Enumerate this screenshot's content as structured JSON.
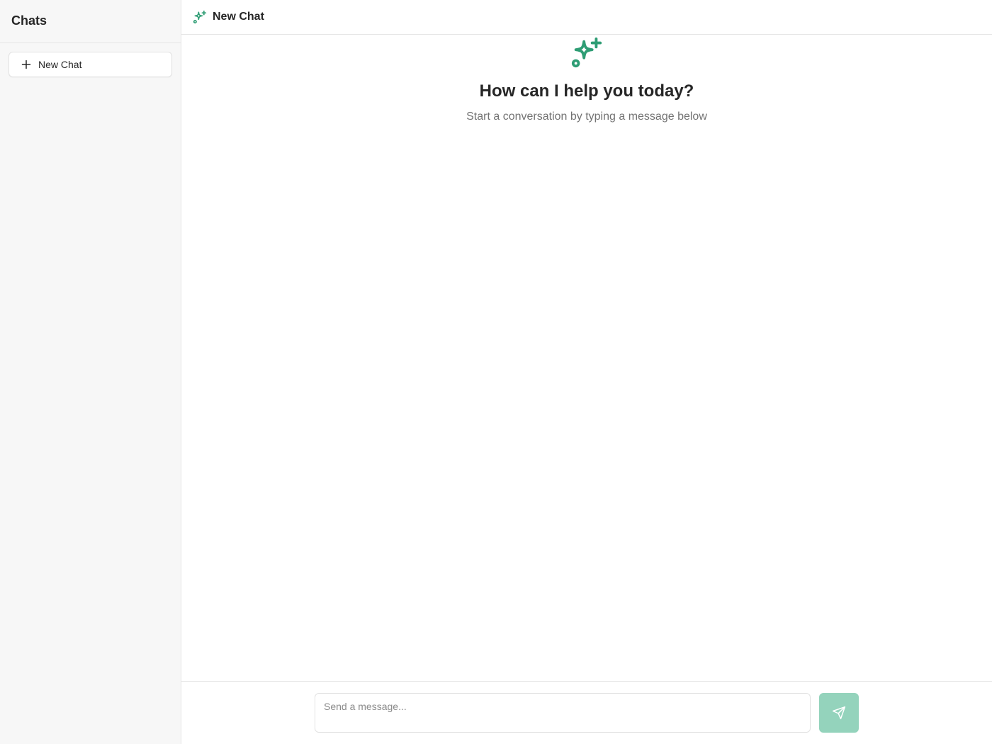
{
  "sidebar": {
    "title": "Chats",
    "new_chat_label": "New Chat"
  },
  "header": {
    "title": "New Chat",
    "icon": "sparkles-icon"
  },
  "empty_state": {
    "icon": "sparkles-icon",
    "title": "How can I help you today?",
    "subtitle": "Start a conversation by typing a message below"
  },
  "composer": {
    "placeholder": "Send a message...",
    "value": "",
    "send_icon": "send-icon"
  },
  "colors": {
    "accent": "#2e9d74",
    "send_button_disabled": "#94d3bc",
    "sidebar_bg": "#f7f7f7",
    "border": "#e5e5e5"
  }
}
